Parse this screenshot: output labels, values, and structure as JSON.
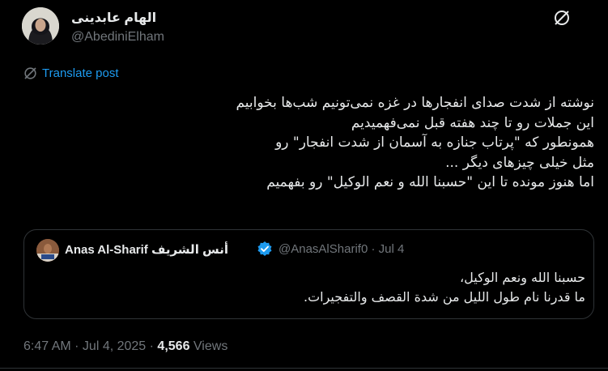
{
  "author": {
    "display_name": "الهام عابدینی",
    "handle": "@AbediniElham"
  },
  "translate": {
    "label": "Translate post"
  },
  "tweet": {
    "lines": [
      "نوشته از شدت صدای انفجارها در غزه نمی‌تونیم شب‌ها بخوابیم",
      "این جملات رو تا چند هفته قبل نمی‌فهمیدیم",
      "همونطور که \"پرتاب جنازه به آسمان از شدت انفجار\" رو",
      "مثل خیلی چیزهای دیگر ...",
      "اما هنوز مونده تا این \"حسبنا الله و نعم الوکیل\" رو بفهمیم"
    ]
  },
  "quote": {
    "display_name": "Anas Al-Sharif أنس الشريف",
    "meta": "@AnasAlSharif0 · Jul 4",
    "lines": [
      "حسبنا الله ونعم الوكيل،",
      "ما قدرنا نام طول الليل من شدة القصف والتفجيرات."
    ]
  },
  "footer": {
    "time": "6:47 AM",
    "sep": " · ",
    "date": "Jul 4, 2025",
    "views_count": "4,566",
    "views_label": "Views"
  },
  "icons": {
    "grok": "grok-icon",
    "translate": "translate-icon",
    "verified": "verified-badge-icon"
  },
  "colors": {
    "background": "#000000",
    "text": "#e7e9ea",
    "muted": "#71767b",
    "accent": "#1d9bf0",
    "border": "#2f3336"
  }
}
